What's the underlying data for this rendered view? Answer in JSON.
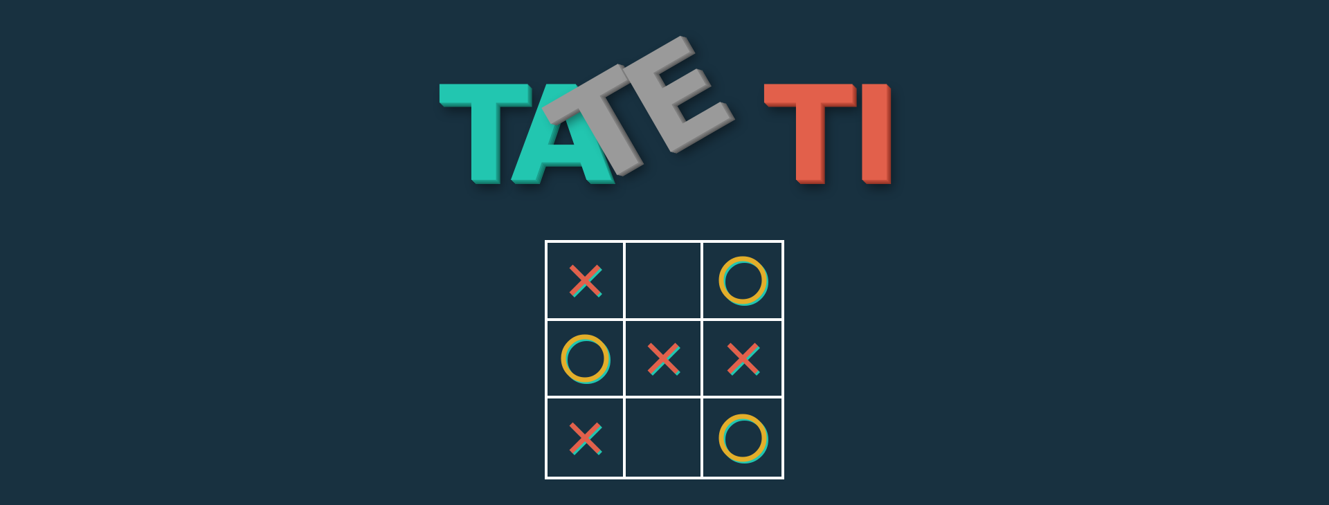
{
  "title": {
    "letters": [
      "T",
      "A",
      "T",
      "E",
      "T",
      "I"
    ],
    "word": "TATETI"
  },
  "colors": {
    "background": "#183140",
    "title_teal": "#22c6b0",
    "title_grey": "#9a9a9a",
    "title_red": "#e2604b",
    "grid_lines": "#ffffff",
    "x_mark": "#e2604b",
    "o_mark": "#e3ae2a",
    "mark_shadow": "#22c6b0"
  },
  "board": {
    "cells": [
      "X",
      "",
      "O",
      "O",
      "X",
      "X",
      "X",
      "",
      "O"
    ]
  }
}
